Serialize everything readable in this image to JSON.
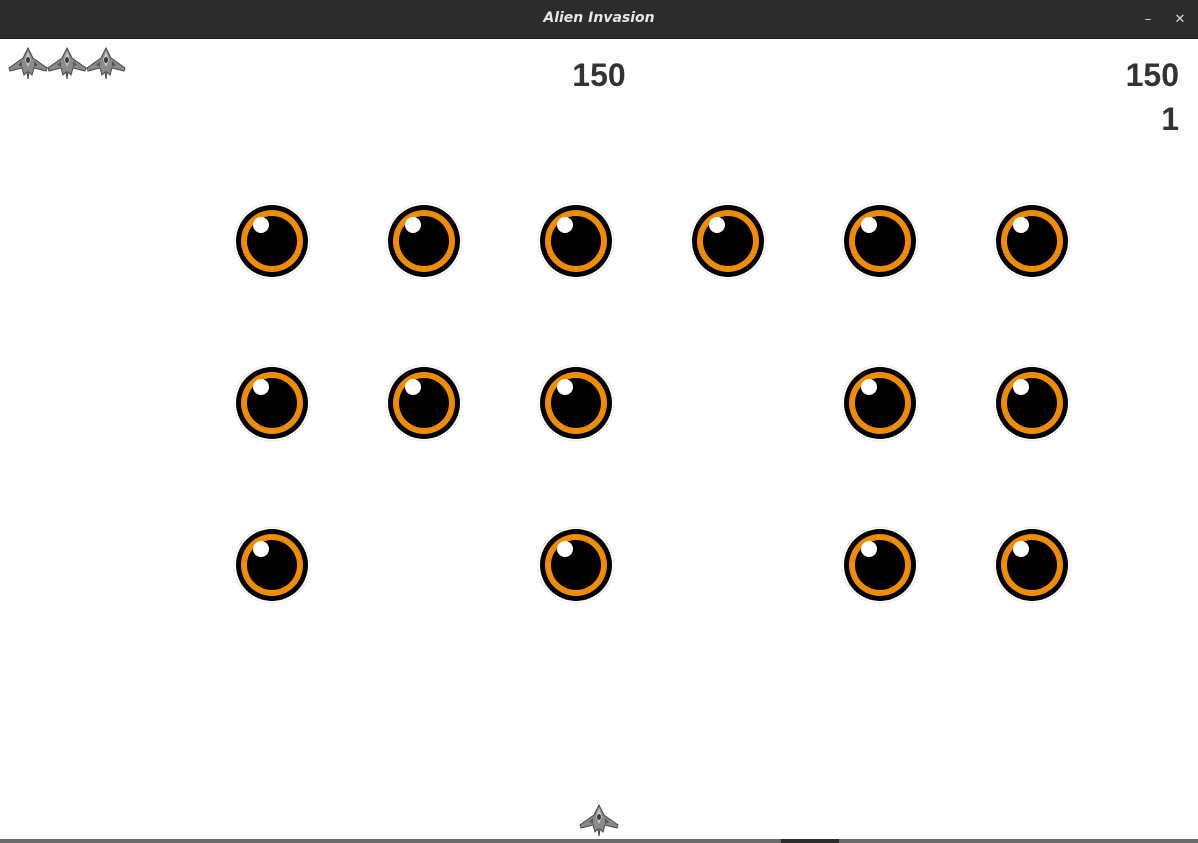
{
  "window": {
    "title": "Alien Invasion",
    "minimize_label": "–",
    "close_label": "✕"
  },
  "hud": {
    "score": "150",
    "high_score": "150",
    "level": "1",
    "lives_remaining": 3,
    "life_icon": "ship-icon"
  },
  "fleet": {
    "alien_icon": "eye-alien-icon",
    "rows": [
      [
        true,
        true,
        true,
        true,
        true,
        true
      ],
      [
        true,
        true,
        true,
        false,
        true,
        true
      ],
      [
        true,
        false,
        true,
        false,
        true,
        true
      ]
    ]
  },
  "player": {
    "icon": "ship-icon"
  },
  "colors": {
    "background": "#ffffff",
    "text": "#333333",
    "alien_iris": "#f08c00",
    "alien_pupil": "#000000",
    "titlebar": "#2c2c2c"
  }
}
